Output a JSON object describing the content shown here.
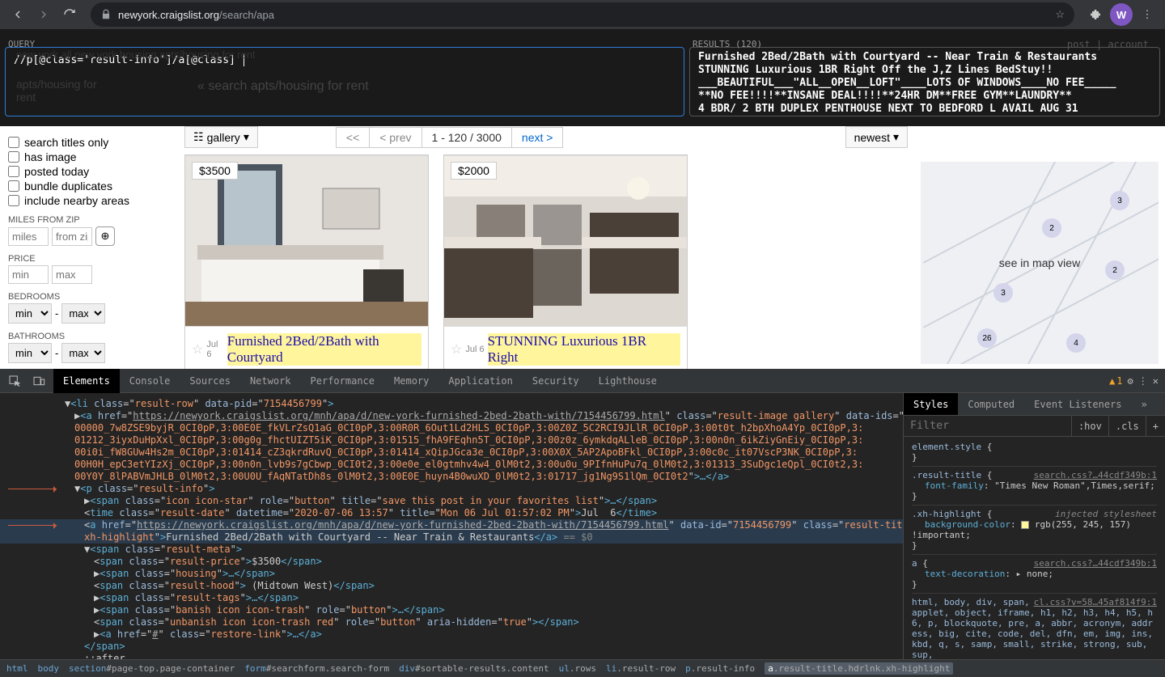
{
  "chrome": {
    "url_host": "newyork.craigslist.org",
    "url_path": "/search/apa",
    "avatar_letter": "W"
  },
  "overlay": {
    "query_label": "QUERY",
    "query_text": "//p[@class='result-info']/a[@class]",
    "results_label": "RESULTS (120)",
    "results": [
      "Furnished 2Bed/2Bath with Courtyard -- Near Train & Restaurants",
      "STUNNING Luxurious 1BR Right Off the J,Z Lines BedStuy!!",
      "___BEAUTIFUL___\"ALL__OPEN__LOFT\"____LOTS OF WINDOWS____NO FEE_____",
      "**NO FEE!!!!**INSANE DEAL!!!!**24HR DM**FREE GYM**LAUNDRY**",
      "4 BDR/ 2 BTH DUPLEX PENTHOUSE NEXT TO BEDFORD L AVAIL AUG 31"
    ],
    "bg_dropdown_text": "new york            all new york        housing             apts/housing for rent",
    "bg_search": "search apts/housing for rent",
    "bg_apts": "apts/housing for\nrent",
    "top_right": "post  |  account"
  },
  "filters": {
    "items": [
      "search titles only",
      "has image",
      "posted today",
      "bundle duplicates",
      "include nearby areas"
    ],
    "miles_label": "MILES FROM ZIP",
    "miles_ph": "miles",
    "zip_ph": "from zip",
    "price_label": "PRICE",
    "min_ph": "min",
    "max_ph": "max",
    "bed_label": "BEDROOMS",
    "bath_label": "BATHROOMS",
    "select_min": "min",
    "select_max": "max"
  },
  "toolbar": {
    "gallery": "gallery",
    "prev_first": "<<",
    "prev": "< prev",
    "range": "1 - 120 / 3000",
    "next": "next >",
    "sort": "newest"
  },
  "cards": [
    {
      "price": "$3500",
      "date": "Jul 6",
      "title": "Furnished 2Bed/2Bath with Courtyard"
    },
    {
      "price": "$2000",
      "date": "Jul 6",
      "title": "STUNNING Luxurious 1BR Right"
    }
  ],
  "map_label": "see in map view",
  "devtools": {
    "tabs": [
      "Elements",
      "Console",
      "Sources",
      "Network",
      "Performance",
      "Memory",
      "Application",
      "Security",
      "Lighthouse"
    ],
    "warn_count": "1",
    "styles_tabs": [
      "Styles",
      "Computed",
      "Event Listeners"
    ],
    "filter_ph": "Filter",
    "hov": ":hov",
    "cls": ".cls",
    "crumbs": [
      {
        "t": "html",
        "s": ""
      },
      {
        "t": "body",
        "s": ""
      },
      {
        "t": "section",
        "s": "#page-top.page-container"
      },
      {
        "t": "form",
        "s": "#searchform.search-form"
      },
      {
        "t": "div",
        "s": "#sortable-results.content"
      },
      {
        "t": "ul",
        "s": ".rows"
      },
      {
        "t": "li",
        "s": ".result-row"
      },
      {
        "t": "p",
        "s": ".result-info"
      },
      {
        "t": "a",
        "s": ".result-title.hdrlnk.xh-highlight",
        "sel": true
      }
    ],
    "elements_html": [
      {
        "indent": 80,
        "html": "▼<span class='tag'>&lt;li</span> <span class='attr'>class</span>=\"<span class='val'>result-row</span>\" <span class='attr'>data-pid</span>=\"<span class='val'>7154456799</span>\"<span class='tag'>&gt;</span>"
      },
      {
        "indent": 92,
        "html": "▶<span class='tag'>&lt;a</span> <span class='attr'>href</span>=\"<span class='str'>https://newyork.craigslist.org/mnh/apa/d/new-york-furnished-2bed-2bath-with/7154456799.html</span>\" <span class='attr'>class</span>=\"<span class='val'>result-image gallery</span>\" <span class='attr'>data-ids</span>=\"<span class='val'>3:</span>"
      },
      {
        "indent": 92,
        "html": "<span class='val'>00000_7w8ZSE9byjR_0CI0pP,3:00E0E_fkVLrZsQ1aG_0CI0pP,3:00R0R_6Out1Ld2HLS_0CI0pP,3:00Z0Z_5C2RCI9JLlR_0CI0pP,3:00t0t_h2bpXhoA4Yp_0CI0pP,3:</span>"
      },
      {
        "indent": 92,
        "html": "<span class='val'>01212_3iyxDuHpXxl_0CI0pP,3:00g0g_fhctUIZT5iK_0CI0pP,3:01515_fhA9FEqhn5T_0CI0pP,3:00z0z_6ymkdqALleB_0CI0pP,3:00n0n_6ikZiyGnEiy_0CI0pP,3:</span>"
      },
      {
        "indent": 92,
        "html": "<span class='val'>00i0i_fW8GUw4Hs2m_0CI0pP,3:01414_cZ3qkrdRuvQ_0CI0pP,3:01414_xQipJGca3e_0CI0pP,3:00X0X_5AP2ApoBFkl_0CI0pP,3:00c0c_it07VscP3NK_0CI0pP,3:</span>"
      },
      {
        "indent": 92,
        "html": "<span class='val'>00H0H_epC3etYIzXj_0CI0pP,3:00n0n_lvb9s7gCbwp_0CI0t2,3:00e0e_el0gtmhv4w4_0lM0t2,3:00u0u_9PIfnHuPu7q_0lM0t2,3:01313_3SuDgc1eQpl_0CI0t2,3:</span>"
      },
      {
        "indent": 92,
        "html": "<span class='val'>00Y0Y_8lPABVmJHLB_0lM0t2,3:00U0U_fAqNTatDh8s_0lM0t2,3:00E0E_huyn4B0wuXD_0lM0t2,3:01717_jg1Ng9S1lQm_0CI0t2</span>\"<span class='tag'>&gt;…&lt;/a&gt;</span>"
      },
      {
        "indent": 92,
        "marker": true,
        "html": "▼<span class='tag'>&lt;p</span> <span class='attr'>class</span>=\"<span class='val'>result-info</span>\"<span class='tag'>&gt;</span>"
      },
      {
        "indent": 104,
        "html": "▶<span class='tag'>&lt;span</span> <span class='attr'>class</span>=\"<span class='val'>icon icon-star</span>\" <span class='attr'>role</span>=\"<span class='val'>button</span>\" <span class='attr'>title</span>=\"<span class='val'>save this post in your favorites list</span>\"<span class='tag'>&gt;…&lt;/span&gt;</span>"
      },
      {
        "indent": 104,
        "html": "&lt;<span class='tag'>time</span> <span class='attr'>class</span>=\"<span class='val'>result-date</span>\" <span class='attr'>datetime</span>=\"<span class='val'>2020-07-06 13:57</span>\" <span class='attr'>title</span>=\"<span class='val'>Mon 06 Jul 01:57:02 PM</span>\"<span class='tag'>&gt;</span><span class='txt'>Jul  6</span><span class='tag'>&lt;/time&gt;</span>"
      },
      {
        "indent": 104,
        "hl": true,
        "marker": true,
        "html": "&lt;<span class='tag'>a</span> <span class='attr'>href</span>=\"<span class='str'>https://newyork.craigslist.org/mnh/apa/d/new-york-furnished-2bed-2bath-with/7154456799.html</span>\" <span class='attr'>data-id</span>=\"<span class='val'>7154456799</span>\" <span class='attr'>class</span>=\"<span class='val'>result-title hdrlnk </span>"
      },
      {
        "indent": 104,
        "hl": true,
        "html": "<span class='val'>xh-highlight</span>\"<span class='tag'>&gt;</span><span class='txt'>Furnished 2Bed/2Bath with Courtyard -- Near Train &amp; Restaurants</span><span class='tag'>&lt;/a&gt;</span> <span style='color:#888'>== $0</span>"
      },
      {
        "indent": 104,
        "html": "▼<span class='tag'>&lt;span</span> <span class='attr'>class</span>=\"<span class='val'>result-meta</span>\"<span class='tag'>&gt;</span>"
      },
      {
        "indent": 116,
        "html": "&lt;<span class='tag'>span</span> <span class='attr'>class</span>=\"<span class='val'>result-price</span>\"<span class='tag'>&gt;</span><span class='txt'>$3500</span><span class='tag'>&lt;/span&gt;</span>"
      },
      {
        "indent": 116,
        "html": "▶<span class='tag'>&lt;span</span> <span class='attr'>class</span>=\"<span class='val'>housing</span>\"<span class='tag'>&gt;…&lt;/span&gt;</span>"
      },
      {
        "indent": 116,
        "html": "&lt;<span class='tag'>span</span> <span class='attr'>class</span>=\"<span class='val'>result-hood</span>\"<span class='tag'>&gt;</span><span class='txt'> (Midtown West)</span><span class='tag'>&lt;/span&gt;</span>"
      },
      {
        "indent": 116,
        "html": "▶<span class='tag'>&lt;span</span> <span class='attr'>class</span>=\"<span class='val'>result-tags</span>\"<span class='tag'>&gt;…&lt;/span&gt;</span>"
      },
      {
        "indent": 116,
        "html": "▶<span class='tag'>&lt;span</span> <span class='attr'>class</span>=\"<span class='val'>banish icon icon-trash</span>\" <span class='attr'>role</span>=\"<span class='val'>button</span>\"<span class='tag'>&gt;…&lt;/span&gt;</span>"
      },
      {
        "indent": 116,
        "html": "&lt;<span class='tag'>span</span> <span class='attr'>class</span>=\"<span class='val'>unbanish icon icon-trash red</span>\" <span class='attr'>role</span>=\"<span class='val'>button</span>\" <span class='attr'>aria-hidden</span>=\"<span class='val'>true</span>\"<span class='tag'>&gt;&lt;/span&gt;</span>"
      },
      {
        "indent": 116,
        "html": "▶<span class='tag'>&lt;a</span> <span class='attr'>href</span>=\"<span class='str'>#</span>\" <span class='attr'>class</span>=\"<span class='val'>restore-link</span>\"<span class='tag'>&gt;…&lt;/a&gt;</span>"
      },
      {
        "indent": 104,
        "html": "<span class='tag'>&lt;/span&gt;</span>"
      },
      {
        "indent": 104,
        "html": "<span class='txt'>::after</span>"
      }
    ],
    "styles_body": [
      {
        "t": "rule",
        "sel": "element.style",
        "src": "",
        "lines": []
      },
      {
        "t": "rule",
        "sel": ".result-title",
        "src": "search.css?…44cdf349b:1",
        "lines": [
          "font-family: \"Times New Roman\",Times,serif;"
        ]
      },
      {
        "t": "rule",
        "sel": ".xh-highlight",
        "note": "injected stylesheet",
        "lines": [
          "background-color: ▣ rgb(255, 245, 157) !important;"
        ]
      },
      {
        "t": "rule",
        "sel": "a",
        "src": "search.css?…44cdf349b:1",
        "lines": [
          "text-decoration: ▸ none;"
        ]
      },
      {
        "t": "block",
        "src": "cl.css?v=58…45af814f9:1",
        "text": "html, body, div, span, applet, object, iframe, h1, h2, h3, h4, h5, h6, p, blockquote, pre, a, abbr, acronym, address, big, cite, code, del, dfn, em, img, ins, kbd, q, s, samp, small, strike, strong, sub, sup,"
      }
    ]
  }
}
